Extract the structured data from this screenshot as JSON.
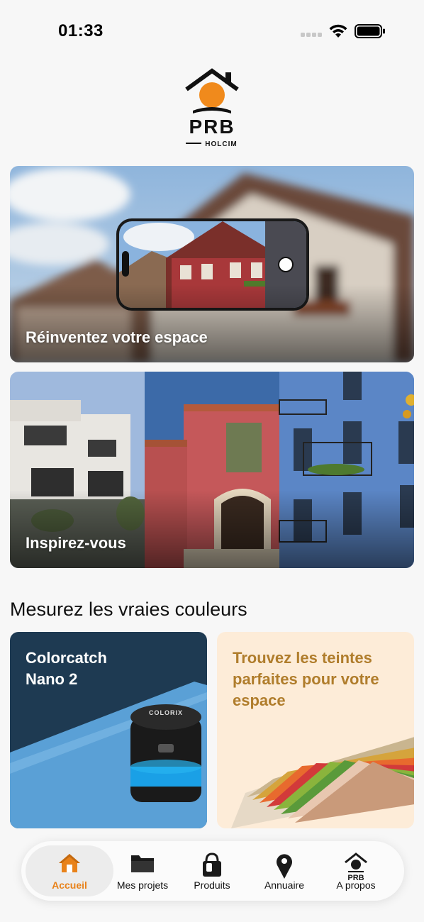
{
  "status_bar": {
    "time": "01:33"
  },
  "brand": {
    "name": "PRB",
    "subtitle": "HOLCIM",
    "accent": "#f08a1c"
  },
  "cards": [
    {
      "title": "Réinventez votre espace"
    },
    {
      "title": "Inspirez-vous"
    }
  ],
  "section": {
    "title": "Mesurez les vraies couleurs"
  },
  "tiles": [
    {
      "title_line1": "Colorcatch",
      "title_line2": "Nano 2",
      "device_label": "COLORIX",
      "color": "#1e3a52"
    },
    {
      "title": "Trouvez les teintes parfaites pour votre espace",
      "color": "#fdecd8",
      "text_color": "#b07d2c"
    }
  ],
  "tab_bar": {
    "active_color": "#e8821a",
    "items": [
      {
        "label": "Accueil",
        "icon": "home-icon"
      },
      {
        "label": "Mes projets",
        "icon": "folder-icon"
      },
      {
        "label": "Produits",
        "icon": "paint-bucket-icon"
      },
      {
        "label": "Annuaire",
        "icon": "location-pin-icon"
      },
      {
        "label": "A propos",
        "icon": "prb-logo-icon"
      }
    ]
  }
}
